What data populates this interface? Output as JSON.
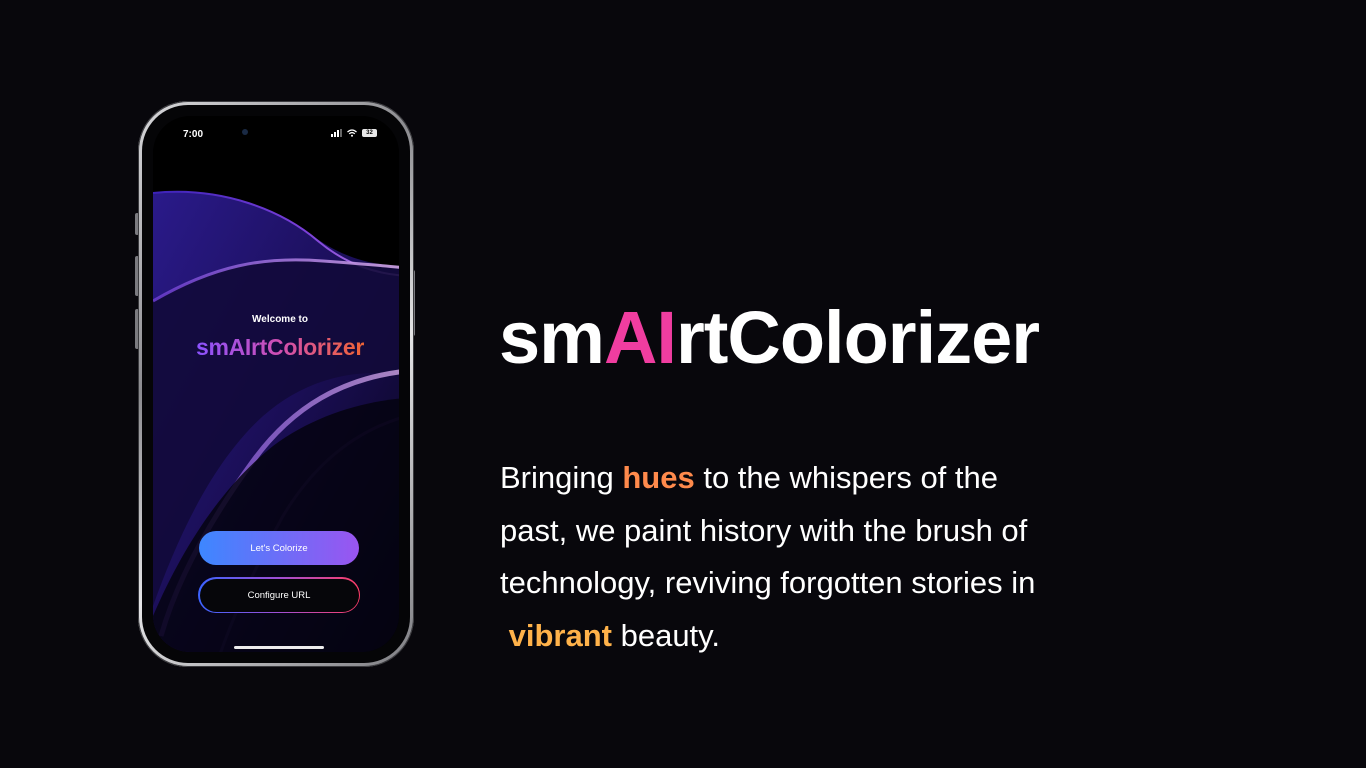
{
  "phone": {
    "status_time": "7:00",
    "battery": "32",
    "welcome_text": "Welcome to",
    "app_name": "smAIrtColorizer",
    "primary_button": "Let's Colorize",
    "secondary_button": "Configure URL"
  },
  "hero": {
    "title_prefix": "sm",
    "title_ai": "AI",
    "title_suffix": "rtColorizer",
    "ai_color": "#f03da0"
  },
  "tagline": {
    "line1_before": "Bringing ",
    "highlight_hues": "hues",
    "line1_after": " to the whispers of the",
    "line2": "past, we paint history with the brush of",
    "line3": "technology, reviving forgotten stories in",
    "highlight_vibrant": "vibrant",
    "line4_after": " beauty.",
    "hues_color": "#ff8a4c",
    "vibrant_color": "#ffb24a"
  },
  "icons": [
    "signal-icon",
    "wifi-icon",
    "battery-icon"
  ]
}
